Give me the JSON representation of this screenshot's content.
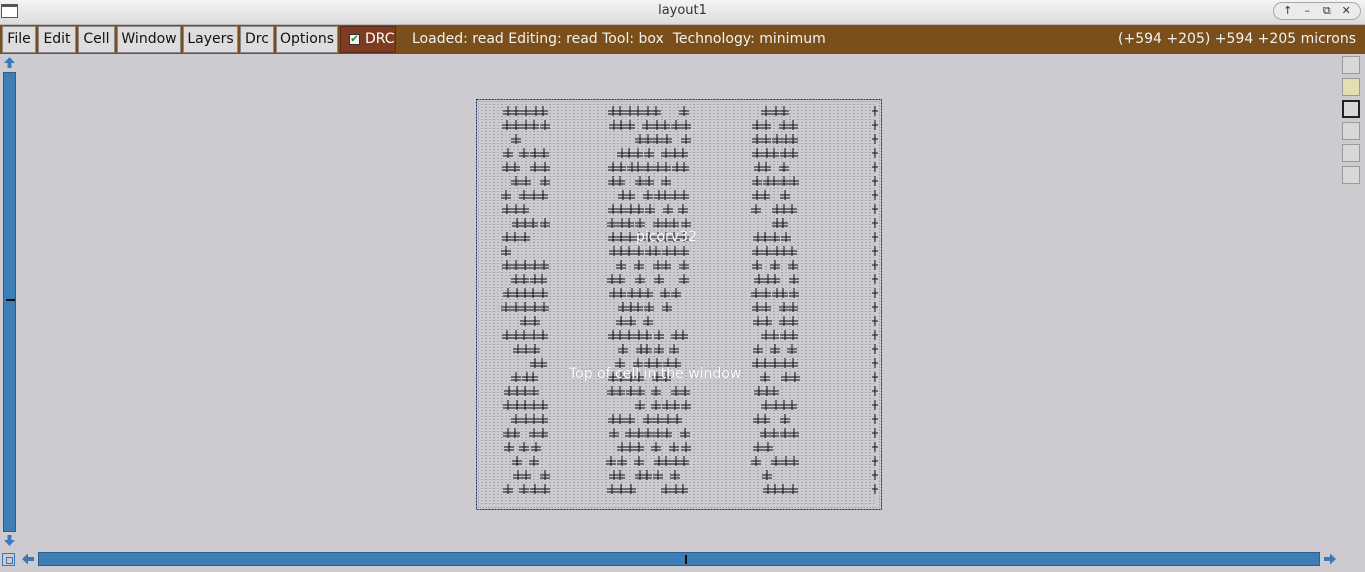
{
  "window": {
    "title": "layout1",
    "controls": [
      "↑",
      "–",
      "⧉",
      "✕"
    ]
  },
  "menu": {
    "items": [
      "File",
      "Edit",
      "Cell",
      "Window",
      "Layers",
      "Drc",
      "Options"
    ],
    "drc_toggle": {
      "label": "DRC",
      "checked": true,
      "check_glyph": "✔"
    }
  },
  "status": {
    "text": "Loaded: read Editing: read Tool: box  Technology: minimum",
    "coordinates": "(+594 +205) +594 +205 microns"
  },
  "layout": {
    "cell_label": "picorv32",
    "message": "Top of cell in the window"
  },
  "colors": {
    "menubar": "#7a4f1b",
    "drc_button": "#7d3b22",
    "scrollbar": "#3d7eb6",
    "canvas_bg": "#cdcbd0"
  },
  "icons": {
    "scroll_up": "arrow-up-icon",
    "scroll_down": "arrow-down-icon",
    "scroll_left": "arrow-left-icon",
    "scroll_right": "arrow-right-icon",
    "zoom": "zoom-box-icon"
  }
}
